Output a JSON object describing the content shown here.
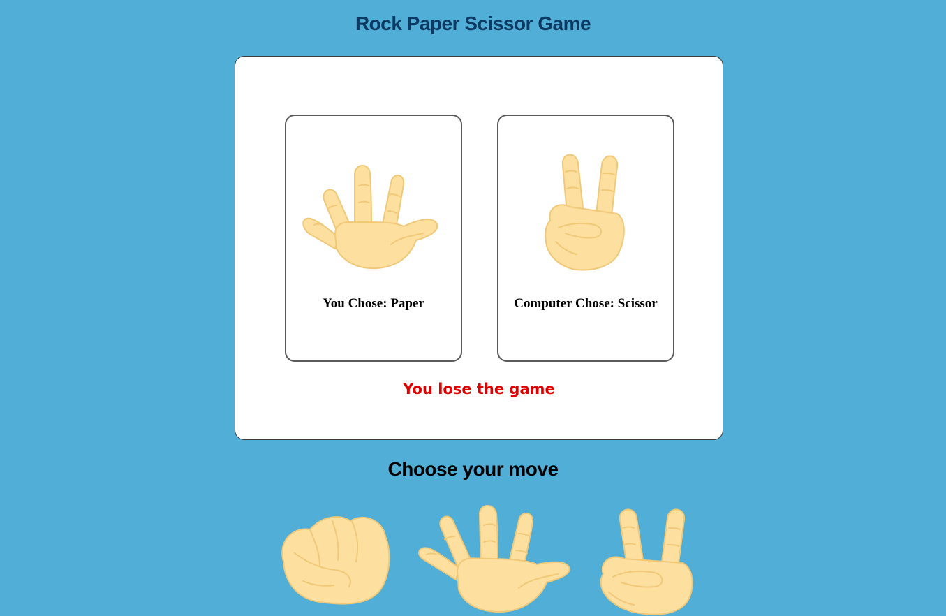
{
  "game": {
    "title": "Rock Paper Scissor Game",
    "choose_heading": "Choose your move"
  },
  "board": {
    "player_caption": "You Chose: Paper",
    "player_choice_icon": "paper-hand-icon",
    "computer_caption": "Computer Chose: Scissor",
    "computer_choice_icon": "scissor-hand-icon",
    "result_text": "You lose the game",
    "result_color": "#e00000"
  },
  "moves": [
    {
      "name": "rock",
      "icon": "rock-hand-icon"
    },
    {
      "name": "paper",
      "icon": "paper-hand-icon"
    },
    {
      "name": "scissor",
      "icon": "scissor-hand-icon"
    }
  ],
  "colors": {
    "background": "#51aed6",
    "title": "#0d3a63",
    "skin": "#fde0a0",
    "skin_line": "#f0c878"
  }
}
